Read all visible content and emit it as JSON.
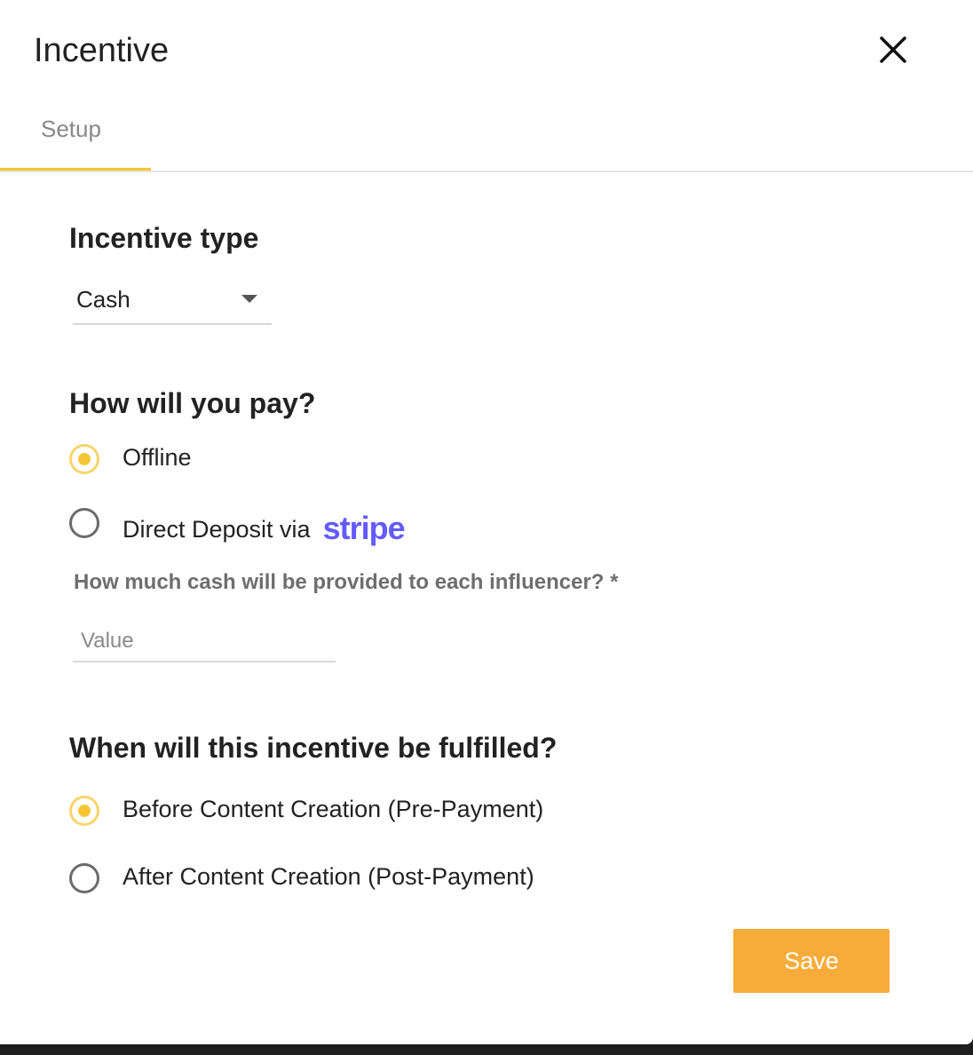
{
  "dialog": {
    "title": "Incentive",
    "close_icon": "close-icon"
  },
  "tabs": [
    {
      "label": "Setup",
      "active": true
    }
  ],
  "colors": {
    "accent": "#f5c634",
    "button": "#f7ac3a",
    "stripe": "#635bff"
  },
  "incentive_type": {
    "heading": "Incentive type",
    "selected": "Cash"
  },
  "payment": {
    "heading": "How will you pay?",
    "options": [
      {
        "label": "Offline",
        "checked": true
      },
      {
        "label": "Direct Deposit via",
        "logo_text": "stripe",
        "checked": false
      }
    ]
  },
  "cash_amount": {
    "label": "How much cash will be provided to each influencer? *",
    "placeholder": "Value",
    "value": ""
  },
  "fulfillment": {
    "heading": "When will this incentive be fulfilled?",
    "options": [
      {
        "label": "Before Content Creation (Pre-Payment)",
        "checked": true
      },
      {
        "label": "After Content Creation (Post-Payment)",
        "checked": false
      }
    ]
  },
  "actions": {
    "save_label": "Save"
  }
}
